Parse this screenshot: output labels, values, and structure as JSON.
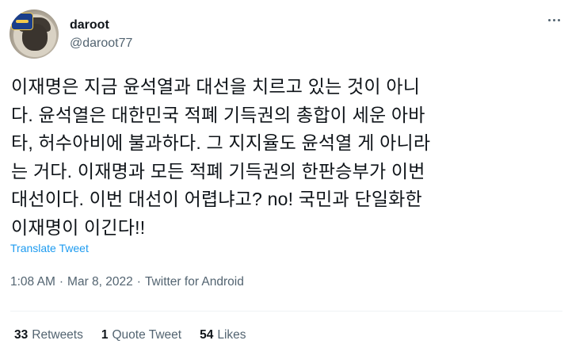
{
  "author": {
    "display_name": "daroot",
    "handle": "@daroot77"
  },
  "tweet": {
    "text": "이재명은 지금 윤석열과 대선을 치르고 있는 것이 아니\n다. 윤석열은 대한민국 적폐 기득권의 총합이 세운 아바\n타, 허수아비에 불과하다. 그 지지율도 윤석열 게 아니라\n는 거다. 이재명과 모든 적폐 기득권의 한판승부가 이번\n대선이다. 이번 대선이 어렵냐고? no! 국민과 단일화한\n이재명이 이긴다!!",
    "translate_label": "Translate Tweet",
    "time": "1:08 AM",
    "separator": "·",
    "date": "Mar 8, 2022",
    "source": "Twitter for Android"
  },
  "stats": {
    "retweets_count": "33",
    "retweets_label": "Retweets",
    "quotes_count": "1",
    "quotes_label": "Quote Tweet",
    "likes_count": "54",
    "likes_label": "Likes"
  },
  "icons": {
    "more": "more-options-icon",
    "avatar": "profile-avatar"
  },
  "colors": {
    "link": "#1d9bf0",
    "secondary_text": "#536471",
    "primary_text": "#0f1419"
  }
}
